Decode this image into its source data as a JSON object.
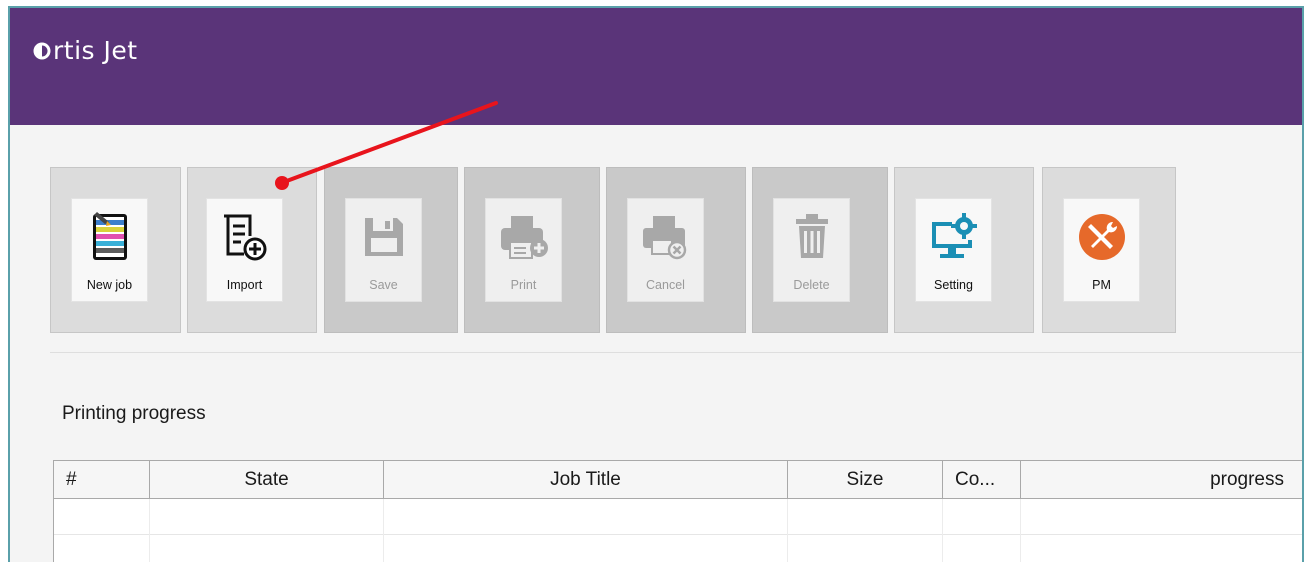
{
  "app": {
    "logo_text": "rtis Jet"
  },
  "toolbar": {
    "buttons": [
      {
        "label": "New job",
        "icon": "new-job-icon",
        "enabled": true
      },
      {
        "label": "Import",
        "icon": "import-icon",
        "enabled": true
      },
      {
        "label": "Save",
        "icon": "save-icon",
        "enabled": false
      },
      {
        "label": "Print",
        "icon": "print-icon",
        "enabled": false
      },
      {
        "label": "Cancel",
        "icon": "cancel-print-icon",
        "enabled": false
      },
      {
        "label": "Delete",
        "icon": "trash-icon",
        "enabled": false
      },
      {
        "label": "Setting",
        "icon": "monitor-gear-icon",
        "enabled": true
      },
      {
        "label": "PM",
        "icon": "tools-icon",
        "enabled": true
      }
    ]
  },
  "progress": {
    "title": "Printing progress",
    "columns": [
      "#",
      "State",
      "Job Title",
      "Size",
      "Co...",
      "progress"
    ],
    "rows": [
      [
        "",
        "",
        "",
        "",
        "",
        ""
      ],
      [
        "",
        "",
        "",
        "",
        "",
        ""
      ]
    ]
  },
  "colors": {
    "titlebar": "#5a3479",
    "accent_arrow": "#e8141c",
    "setting_icon": "#1b8fb5",
    "pm_icon": "#e6692a"
  }
}
